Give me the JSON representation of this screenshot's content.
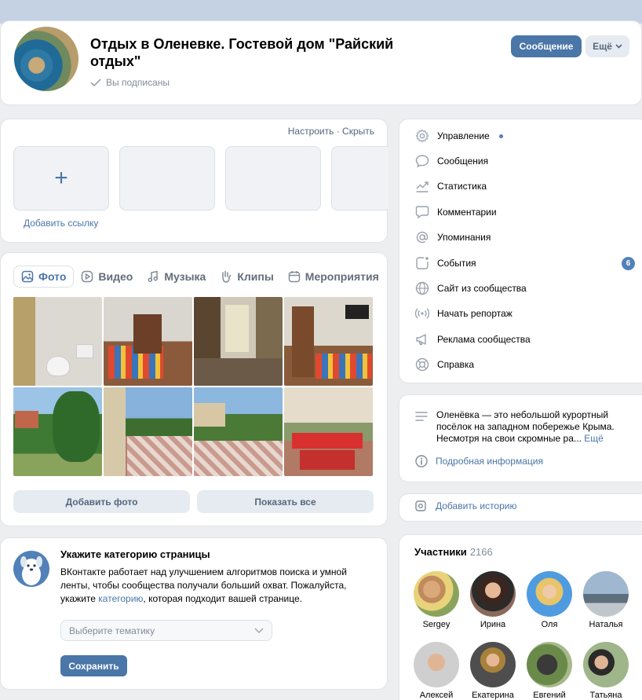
{
  "header": {
    "title": "Отдых в Оленевке. Гостевой дом \"Райский отдых\"",
    "subscribed": "Вы подписаны",
    "message_button": "Сообщение",
    "more_button": "Ещё"
  },
  "links_block": {
    "configure": "Настроить · Скрыть",
    "add_link": "Добавить ссылку"
  },
  "media": {
    "tabs": [
      {
        "label": "Фото",
        "icon": "photo-icon"
      },
      {
        "label": "Видео",
        "icon": "video-icon"
      },
      {
        "label": "Музыка",
        "icon": "music-icon"
      },
      {
        "label": "Клипы",
        "icon": "clips-icon"
      },
      {
        "label": "Мероприятия",
        "icon": "calendar-icon"
      }
    ],
    "add_photo": "Добавить фото",
    "show_all": "Показать все"
  },
  "category": {
    "title": "Укажите категорию страницы",
    "text_before": "ВКонтакте работает над улучшением алгоритмов поиска и умной ленты, чтобы сообщества получали больший охват. Пожалуйста, укажите ",
    "text_link": "категорию",
    "text_after": ", которая подходит вашей странице.",
    "select_placeholder": "Выберите тематику",
    "save_button": "Сохранить"
  },
  "menu": {
    "items": [
      {
        "label": "Управление",
        "icon": "gear-icon"
      },
      {
        "label": "Сообщения",
        "icon": "message-icon"
      },
      {
        "label": "Статистика",
        "icon": "stats-icon"
      },
      {
        "label": "Комментарии",
        "icon": "comment-icon"
      },
      {
        "label": "Упоминания",
        "icon": "at-icon"
      },
      {
        "label": "События",
        "icon": "event-icon",
        "badge": "6"
      },
      {
        "label": "Сайт из сообщества",
        "icon": "globe-icon"
      },
      {
        "label": "Начать репортаж",
        "icon": "broadcast-icon"
      },
      {
        "label": "Реклама сообщества",
        "icon": "megaphone-icon"
      },
      {
        "label": "Справка",
        "icon": "help-icon"
      }
    ]
  },
  "about": {
    "text": "Оленёвка — это небольшой курортный посёлок на западном побережье Крыма. Несмотря на свои скромные ра...",
    "more": "Ещё",
    "details": "Подробная информация"
  },
  "story": {
    "label": "Добавить историю"
  },
  "members": {
    "title": "Участники",
    "count": "2166",
    "people": [
      "Sergey",
      "Ирина",
      "Оля",
      "Наталья",
      "Алексей",
      "Екатерина",
      "Евгений",
      "Татьяна"
    ]
  },
  "colors": {
    "accent": "#4a76a8",
    "background": "#edeef0"
  }
}
